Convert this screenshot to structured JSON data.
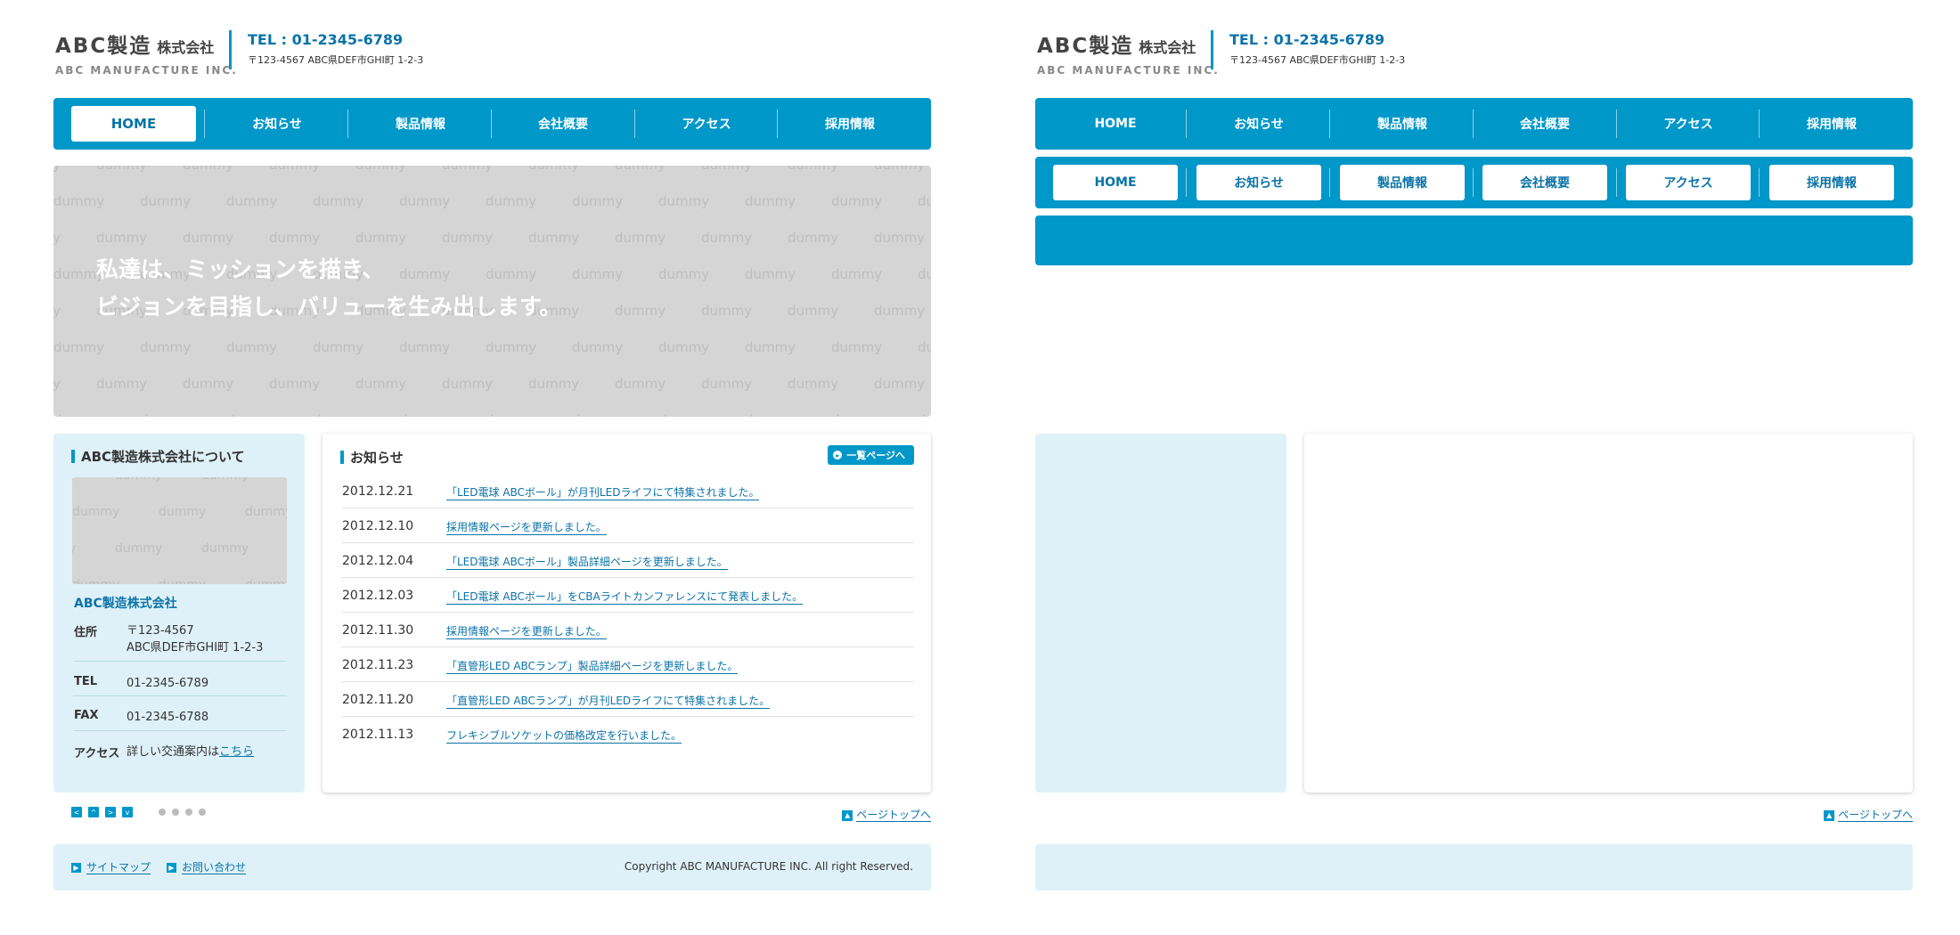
{
  "header": {
    "logo_main": "ABC製造",
    "logo_suffix": "株式会社",
    "logo_sub": "ABC MANUFACTURE INC.",
    "tel": "TEL : 01-2345-6789",
    "address": "〒123-4567 ABC県DEF市GHI町 1-2-3"
  },
  "nav": {
    "items": [
      {
        "label": "HOME"
      },
      {
        "label": "お知らせ"
      },
      {
        "label": "製品情報"
      },
      {
        "label": "会社概要"
      },
      {
        "label": "アクセス"
      },
      {
        "label": "採用情報"
      }
    ],
    "active_index": 0
  },
  "hero": {
    "line1": "私達は、ミッションを描き、",
    "line2": "ビジョンを目指し、バリューを生み出します。",
    "placeholder_word": "dummy"
  },
  "about": {
    "heading": "ABC製造株式会社について",
    "company_name": "ABC製造株式会社",
    "rows": [
      {
        "key": "住所",
        "value_line1": "〒123-4567",
        "value_line2": "ABC県DEF市GHI町 1-2-3"
      },
      {
        "key": "TEL",
        "value": "01-2345-6789"
      },
      {
        "key": "FAX",
        "value": "01-2345-6788"
      },
      {
        "key": "アクセス",
        "value_prefix": "詳しい交通案内は",
        "value_link": "こちら"
      }
    ]
  },
  "news": {
    "heading": "お知らせ",
    "more_label": "一覧ページへ",
    "items": [
      {
        "date": "2012.12.21",
        "title": "「LED電球 ABCボール」が月刊LEDライフにて特集されました。"
      },
      {
        "date": "2012.12.10",
        "title": "採用情報ページを更新しました。"
      },
      {
        "date": "2012.12.04",
        "title": "「LED電球 ABCボール」製品詳細ページを更新しました。"
      },
      {
        "date": "2012.12.03",
        "title": "「LED電球 ABCボール」をCBAライトカンファレンスにて発表しました。"
      },
      {
        "date": "2012.11.30",
        "title": "採用情報ページを更新しました。"
      },
      {
        "date": "2012.11.23",
        "title": "「直管形LED ABCランプ」製品詳細ページを更新しました。"
      },
      {
        "date": "2012.11.20",
        "title": "「直管形LED ABCランプ」が月刊LEDライフにて特集されました。"
      },
      {
        "date": "2012.11.13",
        "title": "フレキシブルソケットの価格改定を行いました。"
      }
    ]
  },
  "pager": {
    "buttons": [
      "<",
      "^",
      ">",
      "v"
    ],
    "dot_count": 4
  },
  "page_top": {
    "label": "ページトップへ"
  },
  "footer": {
    "links": [
      {
        "label": "サイトマップ"
      },
      {
        "label": "お問い合わせ"
      }
    ],
    "copyright": "Copyright ABC MANUFACTURE INC. All right Reserved."
  },
  "colors": {
    "accent": "#0097c9",
    "link": "#0a73a8",
    "light_panel": "#dff1f8",
    "placeholder": "#d5d5d5"
  },
  "icons": {
    "more": "circle-arrow-icon",
    "page_top": "chevron-up-icon",
    "footer_link": "chevron-right-icon"
  }
}
